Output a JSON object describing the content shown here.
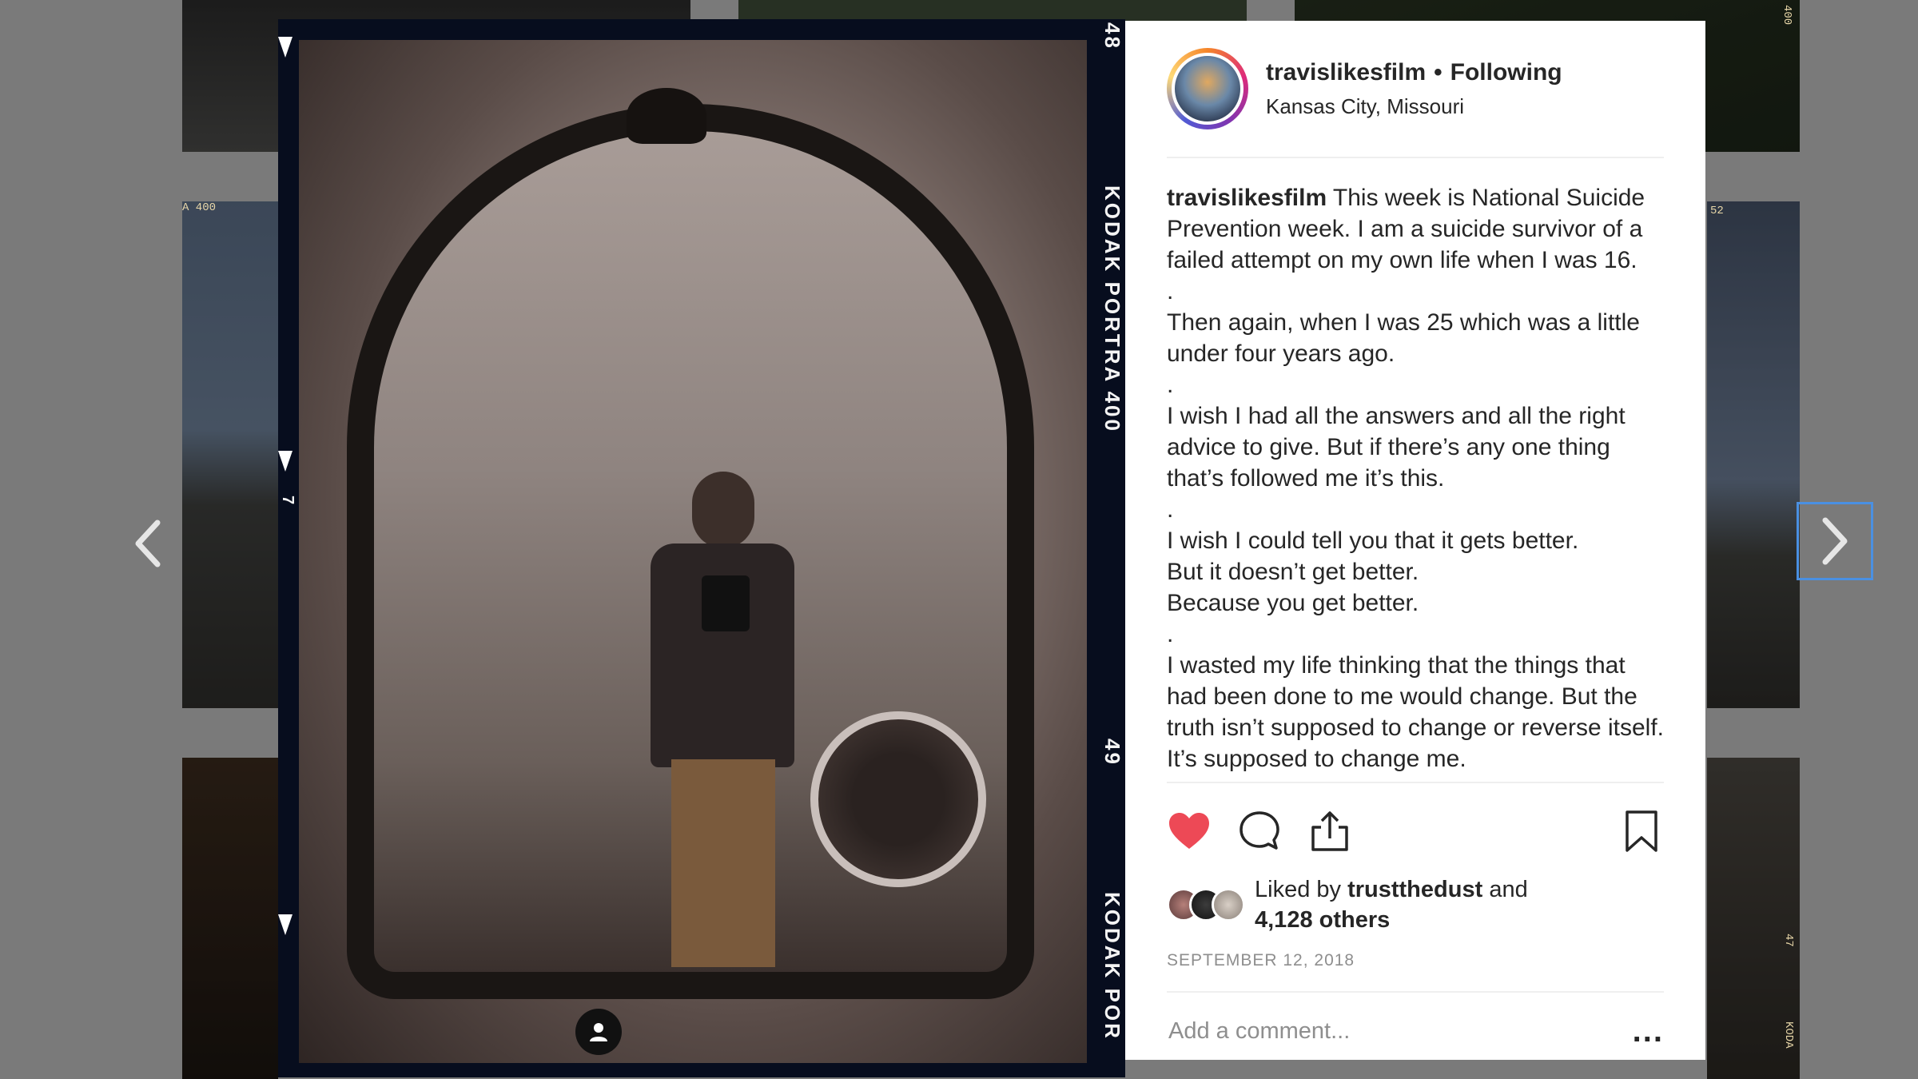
{
  "background": {
    "film_marks": [
      "A 400",
      "52",
      "47",
      "KODA",
      "400"
    ]
  },
  "photo": {
    "film_left_top": "48",
    "film_brand": "KODAK PORTRA 400",
    "film_bottom_num": "49",
    "film_brand_bottom": "KODAK POR",
    "frame_marker": "7"
  },
  "post": {
    "username": "travislikesfilm",
    "separator": "•",
    "following_label": "Following",
    "location": "Kansas City, Missouri",
    "caption": [
      "This week is National Suicide Prevention week. I am a suicide survivor of a failed attempt on my own life when I was 16.",
      ".",
      "Then again, when I was 25 which was a little under four years ago.",
      ".",
      "I wish I had all the answers and all the right advice to give. But if there’s any one thing that’s followed me it’s this.",
      ".",
      "I wish I could tell you that it gets better.",
      "But it doesn’t get better.",
      "Because you get better.",
      ".",
      "I wasted my life thinking that the things that had been done to me would change. But the truth isn’t supposed to change or reverse itself. It’s supposed to change me."
    ],
    "liked_by_prefix": "Liked by",
    "liked_by_user": "trustthedust",
    "liked_by_and": "and",
    "likes_others": "4,128 others",
    "date": "SEPTEMBER 12, 2018",
    "comment_placeholder": "Add a comment...",
    "more_label": "..."
  },
  "colors": {
    "heart": "#ed4956",
    "nav_focus": "#4a90e2"
  },
  "icons": {
    "left": "chevron-left-icon",
    "right": "chevron-right-icon",
    "like": "heart-icon",
    "comment": "comment-icon",
    "share": "share-icon",
    "save": "bookmark-icon",
    "tag": "user-tag-icon"
  }
}
